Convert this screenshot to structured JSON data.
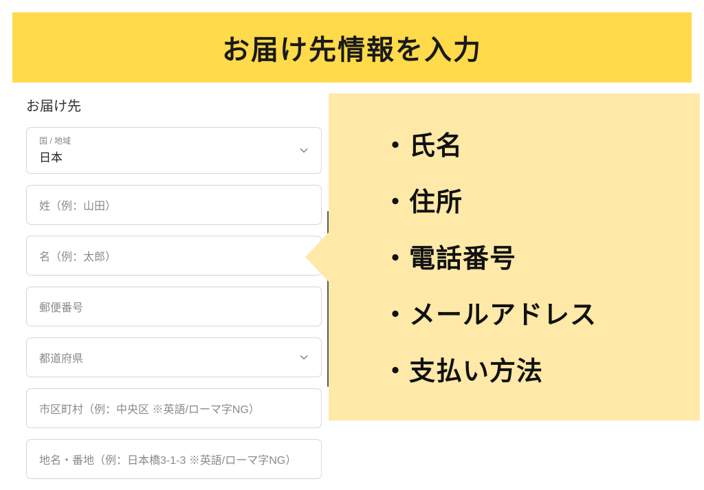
{
  "header": {
    "title": "お届け先情報を入力"
  },
  "form": {
    "section_label": "お届け先",
    "country": {
      "label": "国 / 地域",
      "value": "日本"
    },
    "last_name": {
      "placeholder": "姓（例：山田）"
    },
    "first_name": {
      "placeholder": "名（例：太郎）"
    },
    "postal_code": {
      "placeholder": "郵便番号"
    },
    "prefecture": {
      "placeholder": "都道府県"
    },
    "city": {
      "placeholder": "市区町村（例：中央区 ※英語/ローマ字NG）"
    },
    "address": {
      "placeholder": "地名・番地（例：日本橋3-1-3 ※英語/ローマ字NG）"
    }
  },
  "callout": {
    "items": [
      "・氏名",
      "・住所",
      "・電話番号",
      "・メールアドレス",
      "・支払い方法"
    ]
  },
  "colors": {
    "banner": "#ffda4a",
    "callout": "#ffe9a8",
    "border": "#d6d6d6",
    "placeholder": "#8a8a8a"
  }
}
